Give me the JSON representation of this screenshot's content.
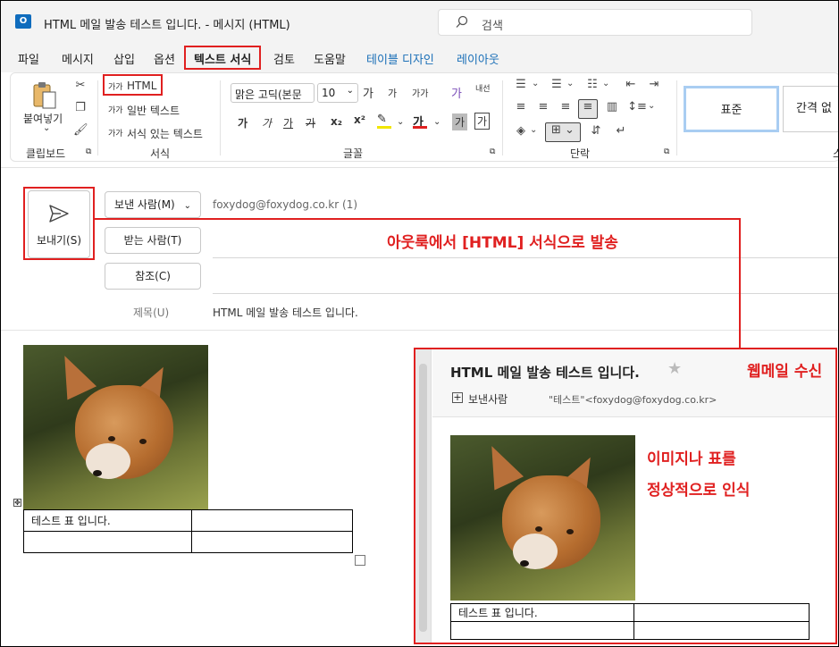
{
  "window": {
    "app_icon": "O",
    "title": "HTML 메일 발송 테스트 입니다.  -  메시지 (HTML)",
    "search_placeholder": "검색"
  },
  "tabs": [
    {
      "label": "파일"
    },
    {
      "label": "메시지"
    },
    {
      "label": "삽입"
    },
    {
      "label": "옵션"
    },
    {
      "label": "텍스트 서식",
      "active": true
    },
    {
      "label": "검토"
    },
    {
      "label": "도움말"
    },
    {
      "label": "테이블 디자인",
      "contextual": true
    },
    {
      "label": "레이아웃",
      "contextual": true
    }
  ],
  "ribbon": {
    "clipboard": {
      "paste_label": "붙여넣기",
      "group_label": "클립보드"
    },
    "format": {
      "html_label": "HTML",
      "plain_label": "일반 텍스트",
      "rich_label": "서식 있는 텍스트",
      "sample": "가가",
      "group_label": "서식"
    },
    "font": {
      "font_name": "맑은 고딕(본문",
      "font_size": "10",
      "grow_label": "가",
      "shrink_label": "가",
      "case_label": "가가",
      "phonetic_label": "내선",
      "bold": "가",
      "italic": "가",
      "underline": "가",
      "strike": "가",
      "subscript": "x₂",
      "superscript": "x²",
      "font_color": "가",
      "shade": "가",
      "border_char": "가",
      "group_label": "글꼴"
    },
    "paragraph": {
      "group_label": "단락"
    },
    "styles": {
      "normal": "표준",
      "spacing": "간격 없",
      "group_label_partial": "스"
    }
  },
  "compose": {
    "send_label": "보내기(S)",
    "from_button": "보낸 사람(M)",
    "from_value": "foxydog@foxydog.co.kr (1)",
    "to_button": "받는 사람(T)",
    "cc_button": "참조(C)",
    "subject_label": "제목(U)",
    "subject_value": "HTML 메일 발송 테스트 입니다.",
    "table_cell": "테스트 표 입니다."
  },
  "annotations": {
    "outlook_note": "아웃룩에서 [HTML] 서식으로 발송",
    "webmail_note": "웹메일 수신",
    "recognize_line1": "이미지나 표를",
    "recognize_line2": "정상적으로 인식"
  },
  "webmail": {
    "subject": "HTML 메일 발송 테스트 입니다.",
    "star": "★",
    "expand": "+",
    "sender_label": "보낸사람",
    "sender_value": "\"테스트\"<foxydog@foxydog.co.kr>",
    "table_cell": "테스트 표 입니다."
  },
  "colors": {
    "highlight_red": "#e02020",
    "outlook_blue": "#0f6cbd",
    "contextual_tab_blue": "#1a6fb7"
  }
}
